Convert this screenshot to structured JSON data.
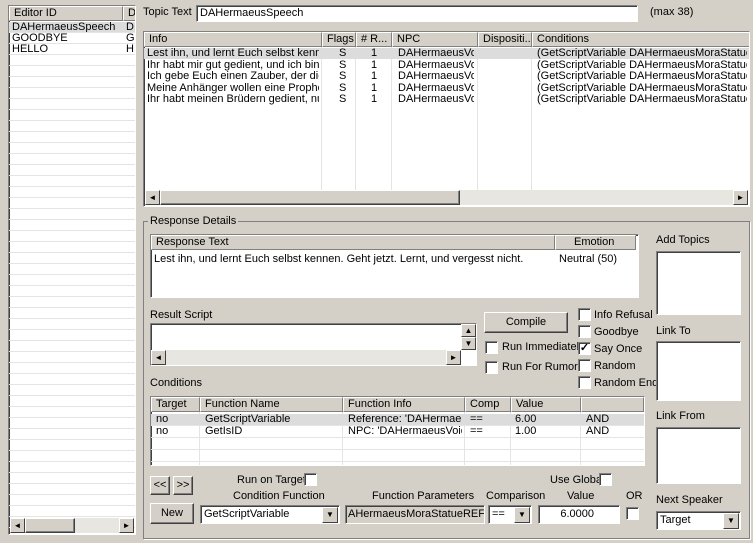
{
  "editor_list": {
    "columns": [
      "Editor ID",
      "D"
    ],
    "rows": [
      {
        "id": "DAHermaeusSpeech",
        "d": "D",
        "selected": true
      },
      {
        "id": "GOODBYE",
        "d": "G",
        "selected": false
      },
      {
        "id": "HELLO",
        "d": "H",
        "selected": false
      }
    ]
  },
  "topic": {
    "label": "Topic Text",
    "value": "DAHermaeusSpeech",
    "max_note": "(max 38)"
  },
  "info_table": {
    "columns": [
      "Info",
      "Flags",
      "# R...",
      "NPC",
      "Dispositi...",
      "Conditions"
    ],
    "rows": [
      {
        "info": "Lest ihn, und lernt Euch selbst kennen...",
        "flags": "S",
        "r": "1",
        "npc": "DAHermaeusVo...",
        "disp": "",
        "cond": "(GetScriptVariable DAHermaeusMoraStatueREF, He"
      },
      {
        "info": "Ihr habt mir gut gedient, und ich bin zuf...",
        "flags": "S",
        "r": "1",
        "npc": "DAHermaeusVo...",
        "disp": "",
        "cond": "(GetScriptVariable DAHermaeusMoraStatueREF, He"
      },
      {
        "info": "Ich gebe Euch einen Zauber, der diese...",
        "flags": "S",
        "r": "1",
        "npc": "DAHermaeusVo...",
        "disp": "",
        "cond": "(GetScriptVariable DAHermaeusMoraStatueREF, He"
      },
      {
        "info": "Meine Anhänger wollen eine Prophezei...",
        "flags": "S",
        "r": "1",
        "npc": "DAHermaeusVo...",
        "disp": "",
        "cond": "(GetScriptVariable DAHermaeusMoraStatueREF, He"
      },
      {
        "info": "Ihr habt meinen Brüdern gedient, nun s...",
        "flags": "S",
        "r": "1",
        "npc": "DAHermaeusVo...",
        "disp": "",
        "cond": "(GetScriptVariable DAHermaeusMoraStatueREF, He"
      }
    ]
  },
  "response": {
    "group_label": "Response Details",
    "columns": [
      "Response Text",
      "Emotion"
    ],
    "rows": [
      {
        "text": "Lest ihn, und lernt Euch selbst kennen. Geht jetzt. Lernt, und vergesst nicht.",
        "emotion": "Neutral (50)"
      }
    ]
  },
  "result_script": {
    "label": "Result Script",
    "compile": "Compile",
    "run_immediately": "Run Immediately",
    "run_for_rumors": "Run For Rumors"
  },
  "flags": {
    "info_refusal": "Info Refusal",
    "goodbye": "Goodbye",
    "say_once": "Say Once",
    "random": "Random",
    "random_end": "Random End",
    "checkmark": "✓"
  },
  "conditions": {
    "label": "Conditions",
    "columns": [
      "Target",
      "Function Name",
      "Function Info",
      "Comp",
      "Value",
      ""
    ],
    "rows": [
      {
        "target": "no",
        "fn": "GetScriptVariable",
        "info": "Reference: 'DAHermaeu...",
        "comp": "==",
        "value": "6.00",
        "andor": "AND"
      },
      {
        "target": "no",
        "fn": "GetIsID",
        "info": "NPC: 'DAHermaeusVoice'",
        "comp": "==",
        "value": "1.00",
        "andor": "AND"
      }
    ]
  },
  "cond_editor": {
    "prev": "<<",
    "next": ">>",
    "new": "New",
    "run_on_target": "Run on Target",
    "use_global": "Use Global",
    "condition_function_label": "Condition Function",
    "condition_function_value": "GetScriptVariable",
    "function_params_label": "Function Parameters",
    "function_params_value": "AHermaeusMoraStatueREF', Her",
    "comparison_label": "Comparison",
    "comparison_value": "==",
    "value_label": "Value",
    "value_value": "6.0000",
    "or_label": "OR"
  },
  "side": {
    "add_topics": "Add Topics",
    "link_to": "Link To",
    "link_from": "Link From",
    "next_speaker": "Next Speaker",
    "next_speaker_value": "Target"
  },
  "glyphs": {
    "left": "◄",
    "right": "►",
    "up": "▲",
    "down": "▼"
  }
}
